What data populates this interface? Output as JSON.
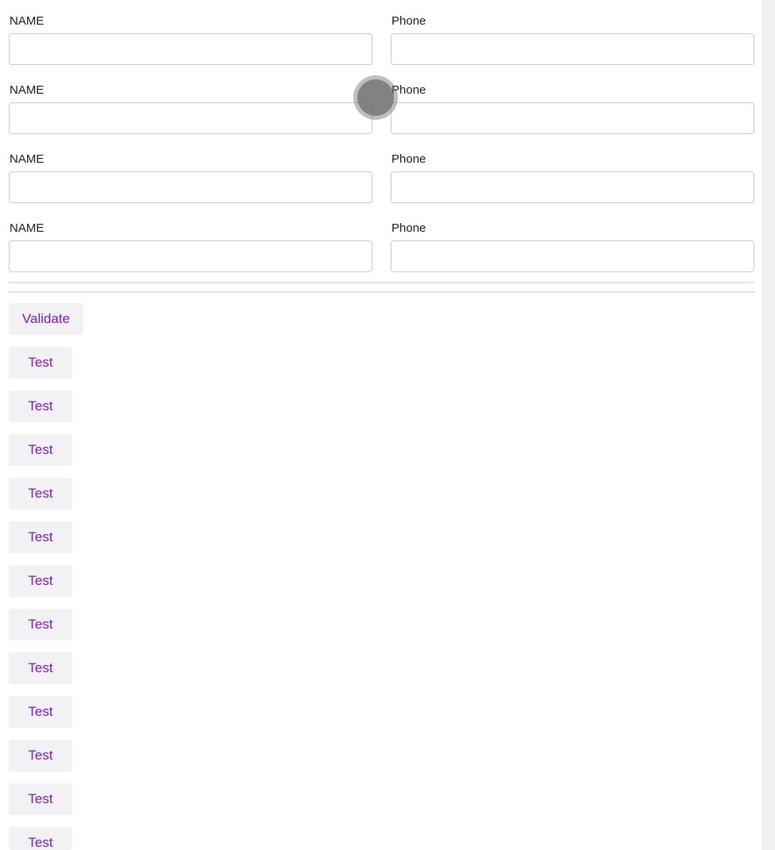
{
  "form": {
    "rows": [
      {
        "name_label": "NAME",
        "name_value": "",
        "phone_label": "Phone",
        "phone_value": ""
      },
      {
        "name_label": "NAME",
        "name_value": "",
        "phone_label": "Phone",
        "phone_value": ""
      },
      {
        "name_label": "NAME",
        "name_value": "",
        "phone_label": "Phone",
        "phone_value": ""
      },
      {
        "name_label": "NAME",
        "name_value": "",
        "phone_label": "Phone",
        "phone_value": ""
      }
    ]
  },
  "actions": {
    "validate_label": "Validate",
    "test_buttons": [
      "Test",
      "Test",
      "Test",
      "Test",
      "Test",
      "Test",
      "Test",
      "Test",
      "Test",
      "Test",
      "Test",
      "Test"
    ]
  },
  "colors": {
    "accent": "#7a14d6",
    "button_bg": "#f2f2f5",
    "input_border": "#c9c9cf"
  }
}
